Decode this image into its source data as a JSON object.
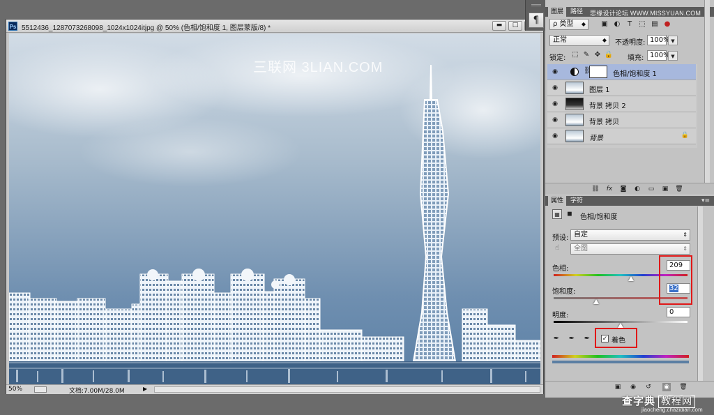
{
  "document": {
    "title": "5512436_1287073268098_1024x1024itjpg @ 50% (色相/饱和度 1, 图层蒙版/8) *",
    "app_icon": "Ps",
    "watermark": "三联网 3LIAN.COM",
    "zoom": "50%",
    "doc_size": "文档:7.00M/28.0M",
    "window_controls": {
      "minimize": "▬",
      "maximize": "□",
      "close": "✕"
    }
  },
  "collapsed_panel": {
    "paragraph_icon": "¶"
  },
  "layers_panel": {
    "tabs": [
      "图层",
      "路径"
    ],
    "site_watermark": "思缘设计论坛 WWW.MISSYUAN.COM",
    "filter_type": "ρ 类型",
    "blend_mode": "正常",
    "opacity_label": "不透明度:",
    "opacity_value": "100%",
    "lock_label": "锁定:",
    "fill_label": "填充:",
    "fill_value": "100%",
    "layers": [
      {
        "name": "色相/饱和度 1",
        "selected": true,
        "kind": "adjustment"
      },
      {
        "name": "图层 1",
        "selected": false,
        "kind": "light"
      },
      {
        "name": "背景 拷贝 2",
        "selected": false,
        "kind": "dark"
      },
      {
        "name": "背景 拷贝",
        "selected": false,
        "kind": "light"
      },
      {
        "name": "背景",
        "selected": false,
        "kind": "background"
      }
    ]
  },
  "properties_panel": {
    "tabs": [
      "属性",
      "字符"
    ],
    "title": "色相/饱和度",
    "preset_label": "预设:",
    "preset_value": "自定",
    "channel_value": "全图",
    "hue_label": "色相:",
    "hue_value": "209",
    "saturation_label": "饱和度:",
    "saturation_value": "32",
    "lightness_label": "明度:",
    "lightness_value": "0",
    "colorize_label": "着色",
    "colorize_checked": true,
    "slider_levels": {
      "hue": 0.58,
      "saturation": 0.32,
      "lightness": 0.5
    }
  },
  "footer_logo": {
    "main": "查字典",
    "sub": "教程网",
    "url": "jiaocheng.chazidian.com"
  },
  "colors": {
    "accent_selection": "#a7b8dd",
    "highlight_box": "#e01818",
    "sky_top": "#c9d5e0",
    "sky_bottom": "#5a7fa5"
  }
}
